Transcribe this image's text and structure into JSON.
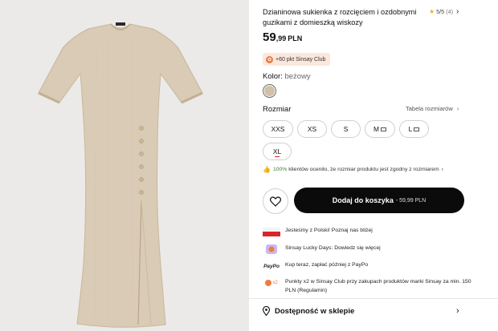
{
  "product": {
    "title": "Dzianinowa sukienka z rozcięciem i ozdobnymi guzikami z domieszką wiskozy",
    "rating": "5/5",
    "rating_count": "(4)",
    "price_int": "59",
    "price_dec": ",99",
    "currency": "PLN",
    "club_badge": "+60 pkt Sinsay Club"
  },
  "color": {
    "label": "Kolor:",
    "value": "beżowy",
    "swatch_color": "#cfc0a8"
  },
  "sizes": {
    "label": "Rozmiar",
    "table_link": "Tabela rozmiarów",
    "options": [
      "XXS",
      "XS",
      "S",
      "M",
      "L",
      "XL"
    ]
  },
  "satisfaction": {
    "percent": "100%",
    "text": "klientów oceniło, że rozmiar produktu jest zgodny z rozmiarem"
  },
  "cart": {
    "label": "Dodaj do koszyka",
    "price": "- 59,99 PLN"
  },
  "info": [
    {
      "icon": "poland-flag-icon",
      "text": "Jesteśmy z Polski! Poznaj nas bliżej"
    },
    {
      "icon": "lucky-days-icon",
      "text": "Sinsay Lucky Days: Dowiedz się więcej"
    },
    {
      "icon": "paypo-icon",
      "icon_text": "PayPo",
      "text": "Kup teraz, zapłać później z PayPo"
    },
    {
      "icon": "points-x2-icon",
      "icon_text": "x2",
      "text": "Punkty x2 w Sinsay Club przy zakupach produktów marki Sinsay za min. 150 PLN (Regulamin)"
    }
  ],
  "availability": {
    "label": "Dostępność w sklepie"
  },
  "colors": {
    "accent": "#0b0b0b",
    "club_bg": "#fbe7dc",
    "club_coin": "#f07b43",
    "dress": "#d9cbb5",
    "flag_red": "#d9252b"
  }
}
